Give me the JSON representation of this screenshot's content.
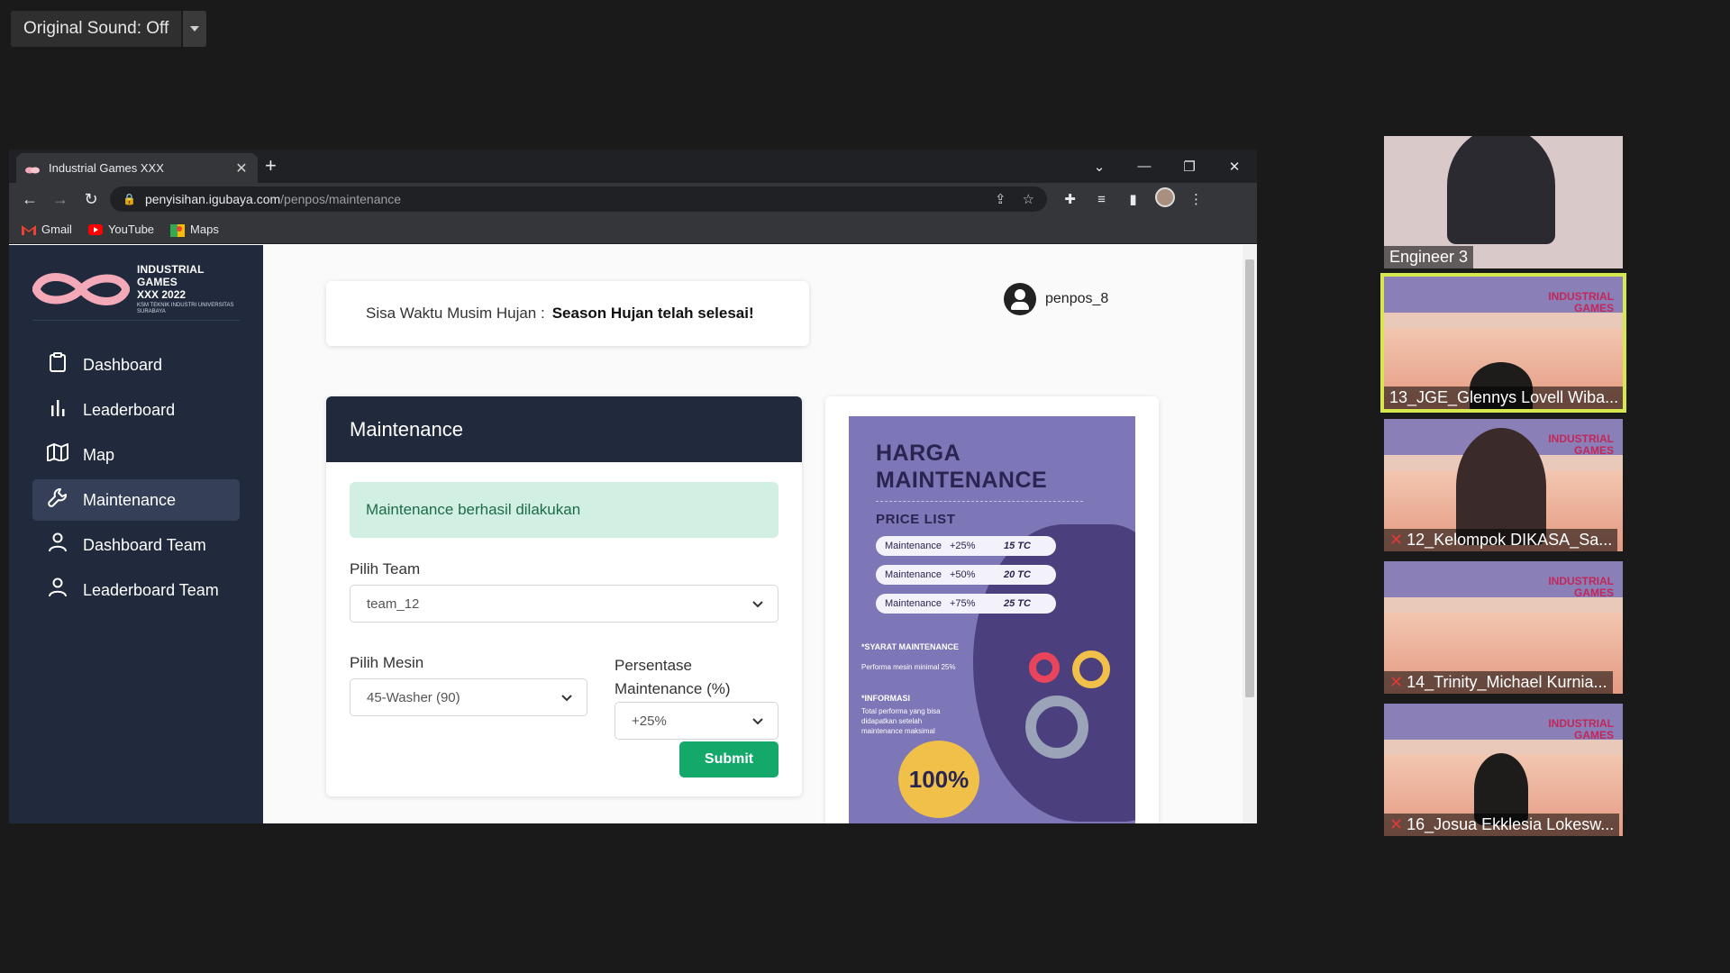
{
  "zoom": {
    "original_sound_label": "Original Sound: Off",
    "participants": [
      {
        "name": "Engineer 3",
        "muted": false
      },
      {
        "name": "13_JGE_Glennys Lovell Wiba...",
        "muted": false
      },
      {
        "name": "12_Kelompok DIKASA_Sa...",
        "muted": true
      },
      {
        "name": "14_Trinity_Michael Kurnia...",
        "muted": true
      },
      {
        "name": "16_Josua Ekklesia Lokesw...",
        "muted": true
      }
    ],
    "poster_brand_line1": "INDUSTRIAL",
    "poster_brand_line2": "GAMES"
  },
  "browser": {
    "tab_title": "Industrial Games XXX",
    "url_domain": "penyisihan.igubaya.com",
    "url_path": "/penpos/maintenance",
    "bookmarks": [
      "Gmail",
      "YouTube",
      "Maps"
    ]
  },
  "sidebar": {
    "logo_line1": "INDUSTRIAL GAMES",
    "logo_line2": "XXX 2022",
    "logo_line3": "KSM TEKNIK INDUSTRI UNIVERSITAS SURABAYA",
    "items": [
      {
        "label": "Dashboard",
        "icon": "clipboard-icon"
      },
      {
        "label": "Leaderboard",
        "icon": "bar-chart-icon"
      },
      {
        "label": "Map",
        "icon": "map-icon"
      },
      {
        "label": "Maintenance",
        "icon": "wrench-icon"
      },
      {
        "label": "Dashboard Team",
        "icon": "user-icon"
      },
      {
        "label": "Leaderboard Team",
        "icon": "user-icon"
      }
    ]
  },
  "header": {
    "timer_label": "Sisa Waktu Musim Hujan :",
    "timer_value": "Season Hujan telah selesai!",
    "username": "penpos_8"
  },
  "maintenance": {
    "title": "Maintenance",
    "alert": "Maintenance berhasil dilakukan",
    "team_label": "Pilih Team",
    "team_value": "team_12",
    "mesin_label": "Pilih Mesin",
    "mesin_value": "45-Washer (90)",
    "persentase_label": "Persentase Maintenance (%)",
    "persentase_value": "+25%",
    "submit_label": "Submit"
  },
  "poster": {
    "title_line1": "HARGA",
    "title_line2": "MAINTENANCE",
    "price_list_label": "PRICE LIST",
    "rows": [
      {
        "name": "Maintenance",
        "pct": "+25%",
        "price": "15 TC"
      },
      {
        "name": "Maintenance",
        "pct": "+50%",
        "price": "20 TC"
      },
      {
        "name": "Maintenance",
        "pct": "+75%",
        "price": "25 TC"
      }
    ],
    "syarat_title": "*SYARAT MAINTENANCE",
    "syarat_text": "Performa mesin minimal 25%",
    "info_title": "*INFORMASI",
    "info_text": "Total performa yang bisa didapatkan setelah maintenance maksimal",
    "badge": "100%"
  }
}
